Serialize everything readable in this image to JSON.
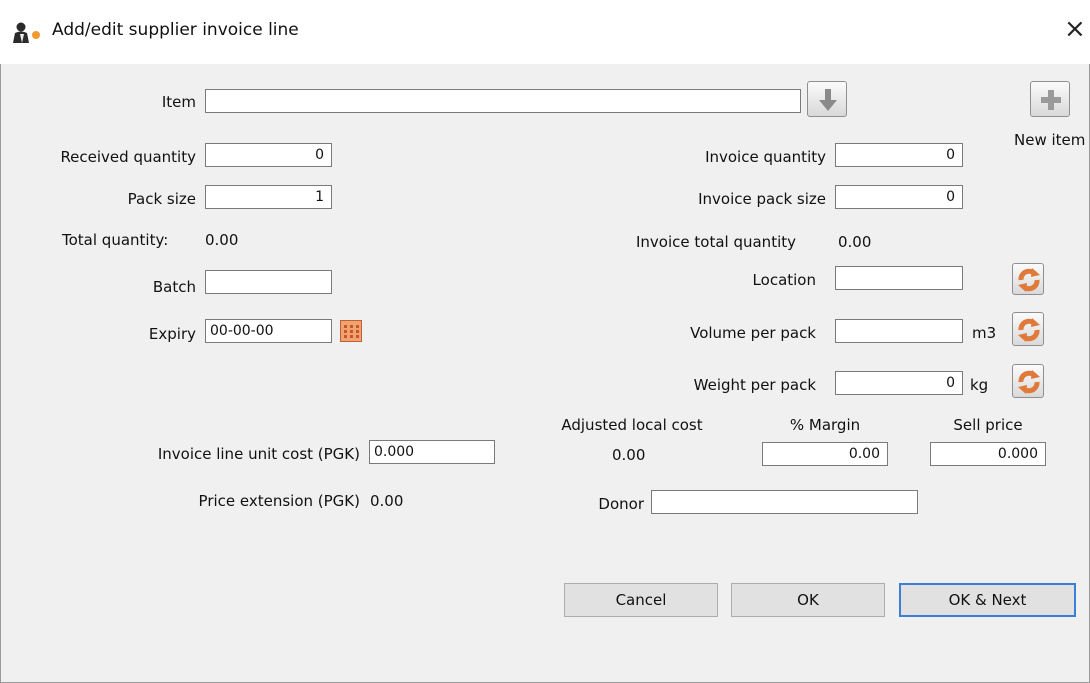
{
  "window": {
    "title": "Add/edit supplier invoice line",
    "close_glyph": "×"
  },
  "item": {
    "label": "Item",
    "value": ""
  },
  "new_item": {
    "label": "New item"
  },
  "received_quantity": {
    "label": "Received quantity",
    "value": "0"
  },
  "pack_size": {
    "label": "Pack size",
    "value": "1"
  },
  "total_quantity": {
    "label": "Total quantity:",
    "value": "0.00"
  },
  "batch": {
    "label": "Batch",
    "value": ""
  },
  "expiry": {
    "label": "Expiry",
    "value": "00-00-00"
  },
  "invoice_quantity": {
    "label": "Invoice quantity",
    "value": "0"
  },
  "invoice_pack_size": {
    "label": "Invoice pack size",
    "value": "0"
  },
  "invoice_total_quantity": {
    "label": "Invoice total quantity",
    "value": "0.00"
  },
  "location": {
    "label": "Location",
    "value": ""
  },
  "volume_per_pack": {
    "label": "Volume per pack",
    "value": "",
    "unit": "m3"
  },
  "weight_per_pack": {
    "label": "Weight per pack",
    "value": "0",
    "unit": "kg"
  },
  "invoice_line_unit_cost": {
    "label": "Invoice line unit cost (PGK)",
    "value": "0.000"
  },
  "adjusted_local_cost": {
    "label": "Adjusted local cost",
    "value": "0.00"
  },
  "margin": {
    "label": "% Margin",
    "value": "0.00"
  },
  "sell_price": {
    "label": "Sell price",
    "value": "0.000"
  },
  "price_extension": {
    "label": "Price extension (PGK)",
    "value": "0.00"
  },
  "donor": {
    "label": "Donor",
    "value": ""
  },
  "buttons": {
    "cancel": "Cancel",
    "ok": "OK",
    "ok_next": "OK & Next"
  },
  "colors": {
    "accent": "#3c7fd6",
    "refresh_orange": "#e07a3a",
    "window_bg": "#f0f0f0"
  },
  "icons": [
    "app-icon",
    "close-icon",
    "down-arrow-icon",
    "plus-icon",
    "calendar-icon",
    "refresh-icon"
  ]
}
